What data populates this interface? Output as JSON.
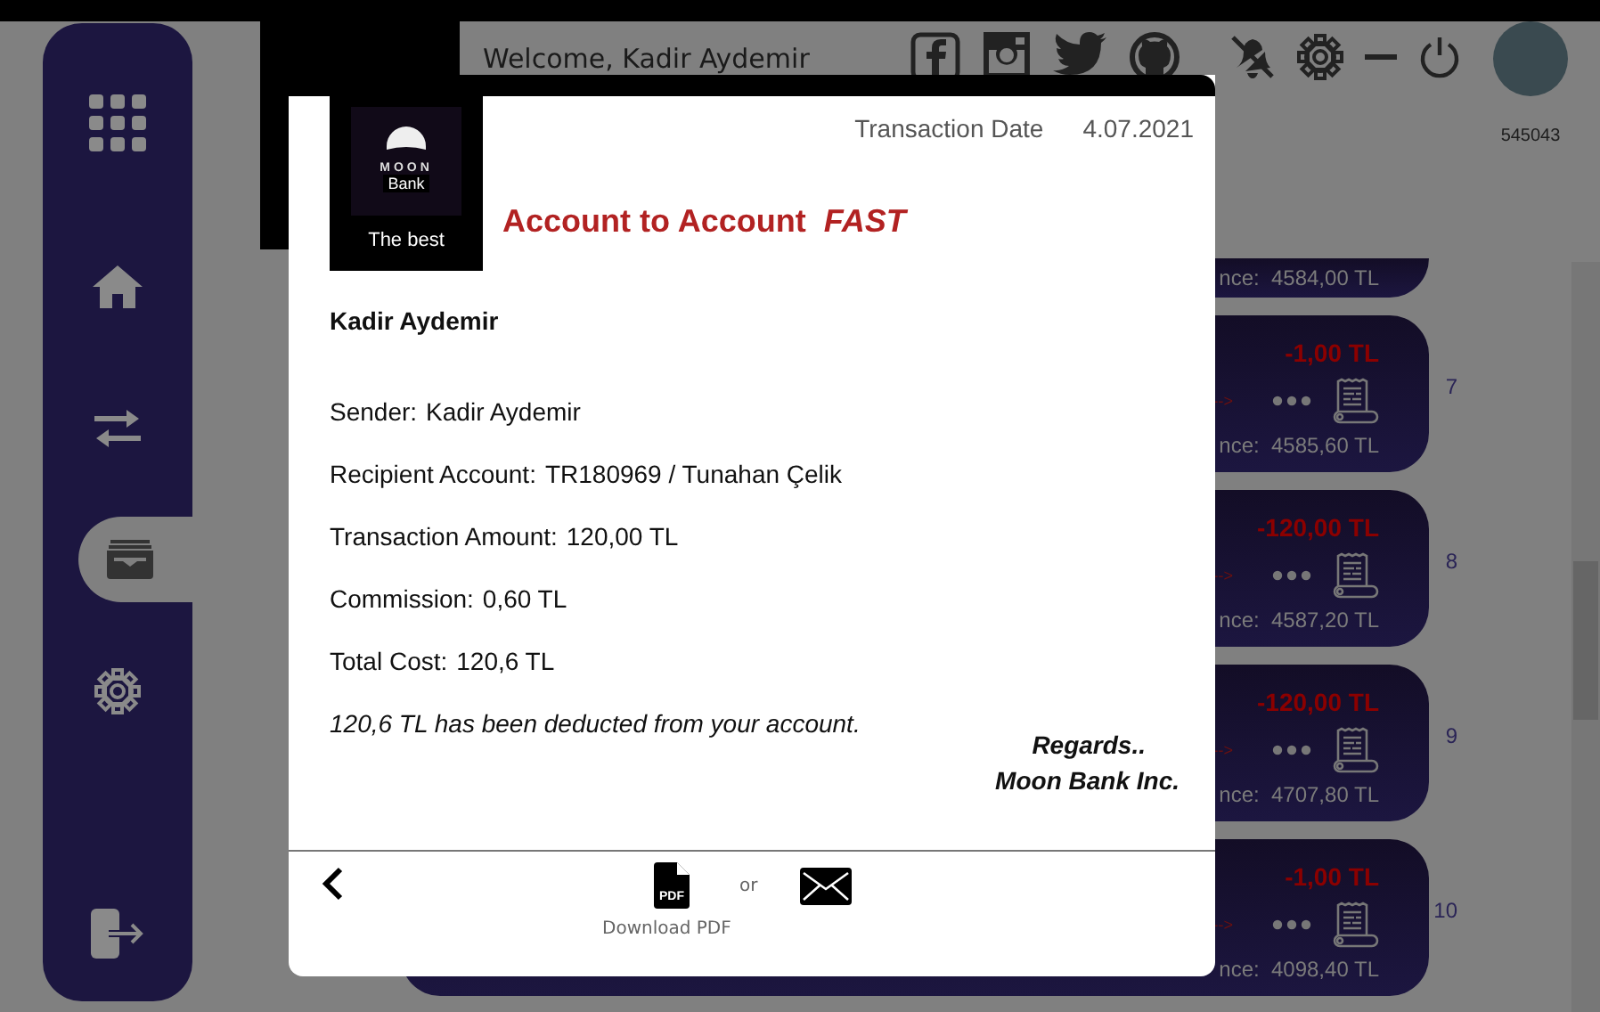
{
  "sidebar": {
    "items": [
      {
        "kind": "apps",
        "selected": false
      },
      {
        "kind": "home",
        "selected": false
      },
      {
        "kind": "transfer",
        "selected": false
      },
      {
        "kind": "wallet",
        "selected": true
      },
      {
        "kind": "settings",
        "selected": false
      },
      {
        "kind": "logout",
        "selected": false
      }
    ]
  },
  "header": {
    "welcome": "Welcome, Kadir Aydemir",
    "customer_number": "545043"
  },
  "transactions": [
    {
      "kind": "partial",
      "balance": "nce:  4584,00 TL"
    },
    {
      "kind": "full",
      "amount": "-1,00 TL",
      "arrow": "-->",
      "balance": "nce:  4585,60 TL",
      "index": "7"
    },
    {
      "kind": "full",
      "amount": "-120,00 TL",
      "arrow": "-->",
      "balance": "nce:  4587,20 TL",
      "index": "8"
    },
    {
      "kind": "full",
      "amount": "-120,00 TL",
      "arrow": "-->",
      "balance": "nce:  4707,80 TL",
      "index": "9"
    },
    {
      "kind": "full",
      "amount": "-1,00 TL",
      "arrow": "-->",
      "balance": "nce:  4098,40 TL",
      "index": "10"
    }
  ],
  "modal": {
    "logo": {
      "line1": "MOON",
      "line2": "Bank",
      "tagline": "The best"
    },
    "date_label": "Transaction Date",
    "date": "4.07.2021",
    "title": "Account to Account",
    "title_tag": "FAST",
    "customer": "Kadir Aydemir",
    "details": [
      {
        "label": "Sender:",
        "value": "Kadir Aydemir"
      },
      {
        "label": "Recipient Account:",
        "value": "TR180969 / Tunahan Çelik"
      },
      {
        "label": "Transaction Amount:",
        "value": "120,00 TL"
      },
      {
        "label": "Commission:",
        "value": "0,60 TL"
      },
      {
        "label": "Total Cost:",
        "value": "120,6 TL"
      }
    ],
    "note": "120,6 TL has been deducted from your account.",
    "regards": "Regards..",
    "signature": "Moon Bank Inc.",
    "or": "or",
    "download_label": "Download PDF",
    "pdf_icon_label": "PDF"
  }
}
